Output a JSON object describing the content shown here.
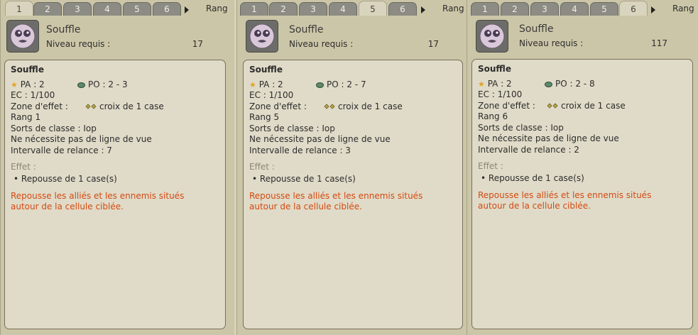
{
  "rang_label": "Rang",
  "spell_name": "Souffle",
  "level_label": "Niveau requis :",
  "panels": [
    {
      "tabs": [
        "1",
        "2",
        "3",
        "4",
        "5",
        "6"
      ],
      "active_tab": "1",
      "level_value": "17",
      "body_title": "Souffle",
      "pa": "PA : 2",
      "po": "PO : 2 - 3",
      "ec": "EC : 1/100",
      "zone_label": "Zone d'effet :",
      "zone_value": "croix de 1 case",
      "rank": "Rang 1",
      "class_spells": "Sorts de classe : Iop",
      "line_of_sight": "Ne nécessite pas de ligne de vue",
      "cooldown": "Intervalle de relance : 7",
      "effect_label": "Effet :",
      "effect_item": "• Repousse de 1 case(s)",
      "desc_line1": "Repousse les alliés et les ennemis situés",
      "desc_line2": "autour de la cellule ciblée."
    },
    {
      "tabs": [
        "1",
        "2",
        "3",
        "4",
        "5",
        "6"
      ],
      "active_tab": "5",
      "level_value": "17",
      "body_title": "Souffle",
      "pa": "PA : 2",
      "po": "PO : 2 - 7",
      "ec": "EC : 1/100",
      "zone_label": "Zone d'effet :",
      "zone_value": "croix de 1 case",
      "rank": "Rang 5",
      "class_spells": "Sorts de classe : Iop",
      "line_of_sight": "Ne nécessite pas de ligne de vue",
      "cooldown": "Intervalle de relance : 3",
      "effect_label": "Effet :",
      "effect_item": "• Repousse de 1 case(s)",
      "desc_line1": "Repousse les alliés et les ennemis situés",
      "desc_line2": "autour de la cellule ciblée."
    },
    {
      "tabs": [
        "1",
        "2",
        "3",
        "4",
        "5",
        "6"
      ],
      "active_tab": "6",
      "level_value": "117",
      "body_title": "Souffle",
      "pa": "PA : 2",
      "po": "PO : 2 - 8",
      "ec": "EC : 1/100",
      "zone_label": "Zone d'effet :",
      "zone_value": "croix de 1 case",
      "rank": "Rang 6",
      "class_spells": "Sorts de classe : Iop",
      "line_of_sight": "Ne nécessite pas de ligne de vue",
      "cooldown": "Intervalle de relance : 2",
      "effect_label": "Effet :",
      "effect_item": "• Repousse de 1 case(s)",
      "desc_line1": "Repousse les alliés et les ennemis situés",
      "desc_line2": "autour de la cellule ciblée."
    }
  ],
  "colors": {
    "description": "#d44a12",
    "muted_label": "#8a8577",
    "star": "#e2a22a",
    "eye": "#5c8a6a"
  }
}
